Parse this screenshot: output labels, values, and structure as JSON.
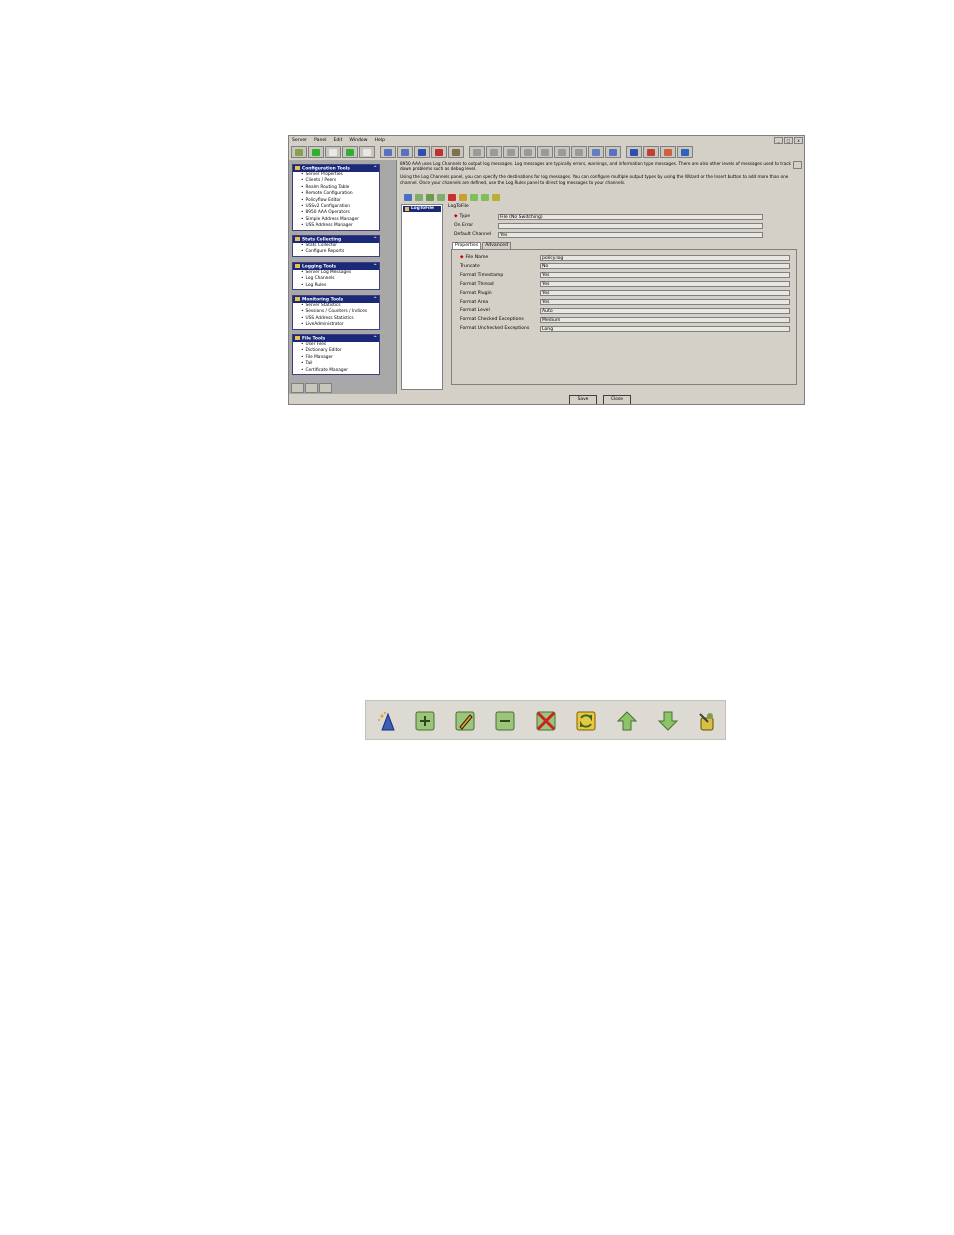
{
  "menu": [
    "Server",
    "Panel",
    "Edit",
    "Window",
    "Help"
  ],
  "window_controls": [
    "_",
    "□",
    "x"
  ],
  "toolbar_icons": [
    "connect-icon",
    "green-light-icon",
    "blank-icon",
    "green-light-icon",
    "blank-icon",
    "save-icon",
    "save-all-icon",
    "refresh-icon",
    "delete-icon",
    "print-icon",
    "sync-icon",
    "cut-icon",
    "copy-icon",
    "paste-icon",
    "find-icon",
    "find-next-icon",
    "key-icon",
    "edit-icon",
    "monitor-icon",
    "help-icon",
    "tools-icon",
    "settings-icon",
    "info-icon"
  ],
  "sidebar": {
    "groups": [
      {
        "title": "Configuration Tools",
        "items": [
          "Server Properties",
          "Clients / Peers",
          "Realm Routing Table",
          "Remote Configuration",
          "Policyflow Editor",
          "USSv2 Configuration",
          "8950 AAA Operators",
          "Simple Address Manager",
          "USS Address Manager"
        ]
      },
      {
        "title": "Stats Collecting",
        "items": [
          "Stats Collector",
          "Configure Reports"
        ]
      },
      {
        "title": "Logging Tools",
        "items": [
          "Server Log Messages",
          "Log Channels",
          "Log Rules"
        ]
      },
      {
        "title": "Monitoring Tools",
        "items": [
          "Server Statistics",
          "Sessions / Counters / Indices",
          "USS Address Statistics",
          "LiveAdministrator"
        ]
      },
      {
        "title": "File Tools",
        "items": [
          "User Files",
          "Dictionary Editor",
          "File Manager",
          "Tail",
          "Certificate Manager"
        ]
      }
    ],
    "collapse_glyph": "^"
  },
  "description": {
    "p1": "8950 AAA uses Log Channels to output log messages. Log messages are typically errors, warnings, and information type messages. There are also other levels of messages used to track down problems such as debug level.",
    "p2": "Using the Log Channels panel, you can specify the destinations for log messages. You can configure multiple output types by using the Wizard or the Insert button to add more than one channel. Once your channels are defined, use the Log Rules panel to direct log messages to your channels."
  },
  "channels": [
    "LogToFile"
  ],
  "detail": {
    "title": "LogToFile",
    "fields": [
      {
        "label": "Type",
        "value": "File (No Switching)",
        "required": true
      },
      {
        "label": "On Error",
        "value": "",
        "required": false
      },
      {
        "label": "Default Channel",
        "value": "Yes",
        "required": false
      }
    ],
    "tabs": [
      "Properties",
      "Advanced"
    ],
    "properties": [
      {
        "label": "File Name",
        "value": "policy.log",
        "required": true
      },
      {
        "label": "Truncate",
        "value": "No",
        "required": false
      },
      {
        "label": "Format Timestamp",
        "value": "Yes",
        "required": false
      },
      {
        "label": "Format Thread",
        "value": "Yes",
        "required": false
      },
      {
        "label": "Format Plugin",
        "value": "Yes",
        "required": false
      },
      {
        "label": "Format Area",
        "value": "Yes",
        "required": false
      },
      {
        "label": "Format Level",
        "value": "Auto",
        "required": false
      },
      {
        "label": "Format Checked Exceptions",
        "value": "Medium",
        "required": false
      },
      {
        "label": "Format Unchecked Exceptions",
        "value": "Long",
        "required": false
      }
    ]
  },
  "buttons": {
    "save": "Save",
    "close": "Close"
  },
  "required_glyph": "◆",
  "channel_toolbar_icons": [
    "wizard-icon",
    "insert-icon",
    "edit-icon",
    "remove-icon",
    "delete-icon",
    "replace-icon",
    "move-up-icon",
    "move-down-icon",
    "test-icon"
  ],
  "colors": {
    "header_blue": "#1a2a78",
    "panel_gray": "#d4d0c8",
    "sidebar_gray": "#a8a8a8",
    "accent_green": "#6aa84f",
    "accent_red": "#cc2222"
  }
}
